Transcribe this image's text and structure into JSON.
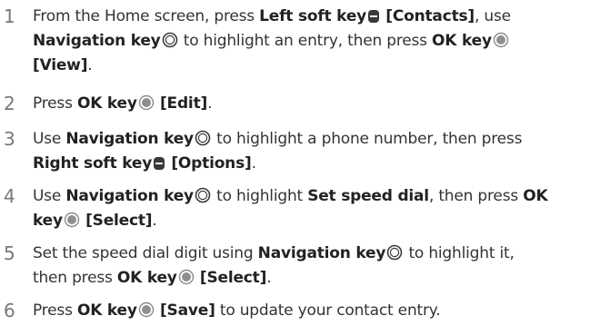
{
  "steps": [
    {
      "number": "1",
      "parts": [
        {
          "t": "From the Home screen, press "
        },
        {
          "b": "Left soft key"
        },
        {
          "icon": "soft-key"
        },
        {
          "b": "[Contacts]"
        },
        {
          "t": ", use"
        },
        {
          "br": true
        },
        {
          "b": "Navigation key"
        },
        {
          "icon": "nav-key"
        },
        {
          "t": "to highlight an entry, then press "
        },
        {
          "b": "OK key"
        },
        {
          "icon": "ok-key"
        },
        {
          "br": true
        },
        {
          "b": "[View]"
        },
        {
          "t": "."
        }
      ]
    },
    {
      "number": "2",
      "parts": [
        {
          "t": "Press "
        },
        {
          "b": "OK key"
        },
        {
          "icon": "ok-key"
        },
        {
          "b": "[Edit]"
        },
        {
          "t": "."
        }
      ]
    },
    {
      "number": "3",
      "parts": [
        {
          "t": "Use "
        },
        {
          "b": "Navigation key"
        },
        {
          "icon": "nav-key"
        },
        {
          "t": "to highlight a phone number, then press"
        },
        {
          "br": true
        },
        {
          "b": "Right soft key"
        },
        {
          "icon": "soft-key"
        },
        {
          "b": "[Options]"
        },
        {
          "t": "."
        }
      ]
    },
    {
      "number": "4",
      "parts": [
        {
          "t": "Use "
        },
        {
          "b": "Navigation key"
        },
        {
          "icon": "nav-key"
        },
        {
          "t": "to highlight "
        },
        {
          "b": "Set speed dial"
        },
        {
          "t": ", then press "
        },
        {
          "b": "OK"
        },
        {
          "br": true
        },
        {
          "b": "key"
        },
        {
          "icon": "ok-key"
        },
        {
          "b": "[Select]"
        },
        {
          "t": "."
        }
      ]
    },
    {
      "number": "5",
      "parts": [
        {
          "t": "Set the speed dial digit using "
        },
        {
          "b": "Navigation key"
        },
        {
          "icon": "nav-key"
        },
        {
          "t": "to highlight it,"
        },
        {
          "br": true
        },
        {
          "t": "then press "
        },
        {
          "b": "OK key"
        },
        {
          "icon": "ok-key"
        },
        {
          "b": "[Select]"
        },
        {
          "t": "."
        }
      ]
    },
    {
      "number": "6",
      "parts": [
        {
          "t": "Press "
        },
        {
          "b": "OK key"
        },
        {
          "icon": "ok-key"
        },
        {
          "b": "[Save]"
        },
        {
          "t": " to update your contact entry."
        }
      ]
    }
  ]
}
